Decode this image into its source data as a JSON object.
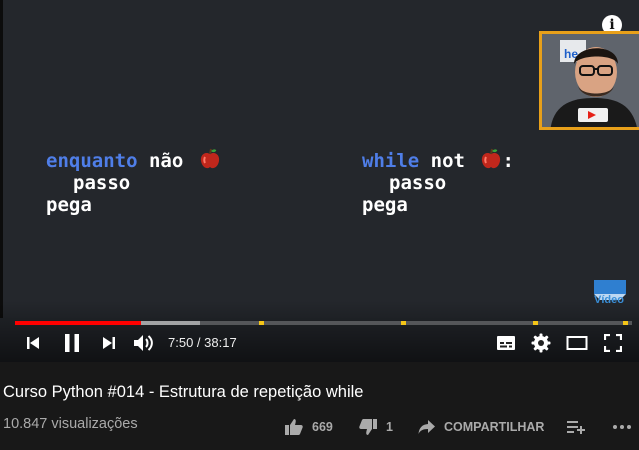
{
  "player": {
    "info_icon": "info-icon",
    "code_left": {
      "line1_keyword": "enquanto",
      "line1_rest": "não",
      "line2": "passo",
      "line3": "pega"
    },
    "code_right": {
      "line1_keyword": "while",
      "line1_rest": "not",
      "line1_suffix": ":",
      "line2": "passo",
      "line3": "pega"
    },
    "watermark_text": "Vídeo",
    "progress": {
      "played_fraction": 0.205,
      "buffered_fraction": 0.3,
      "chapter_markers_fraction": [
        0.395,
        0.625,
        0.84,
        0.985
      ]
    },
    "controls": {
      "time": "7:50 / 38:17",
      "icons": [
        "previous-icon",
        "pause-icon",
        "next-icon",
        "volume-icon",
        "subtitles-icon",
        "settings-icon",
        "theater-icon",
        "fullscreen-icon"
      ]
    },
    "colors": {
      "accent_red": "#ff0000",
      "keyword_blue": "#4f7ee8",
      "marker_yellow": "#f5c518",
      "cam_border": "#e8a01a"
    }
  },
  "video": {
    "title": "Curso Python #014 - Estrutura de repetição while",
    "views": "10.847 visualizações",
    "likes": "669",
    "dislikes": "1",
    "share_label": "COMPARTILHAR"
  }
}
